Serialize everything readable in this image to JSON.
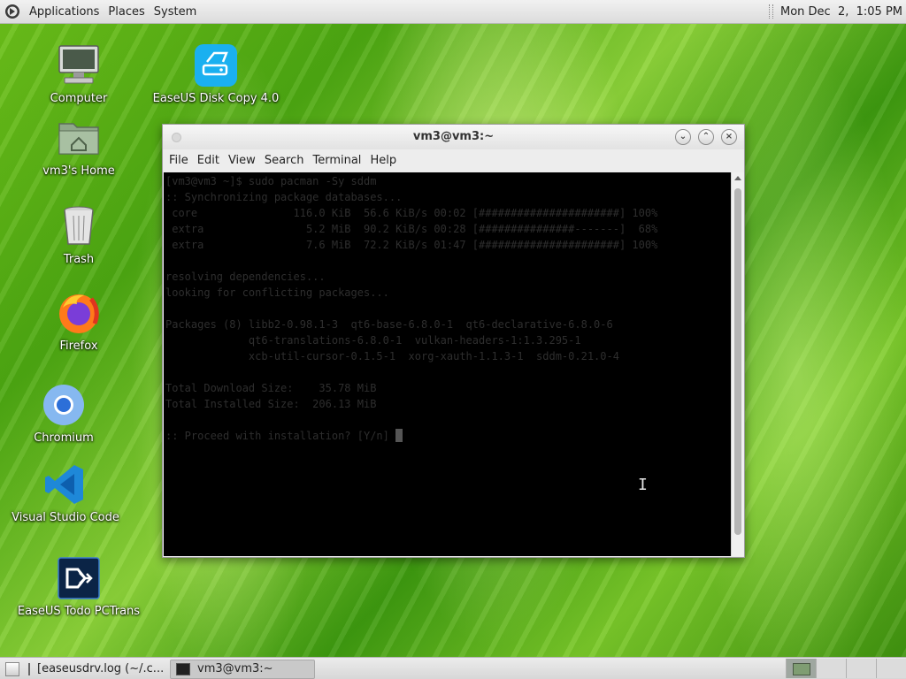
{
  "top_panel": {
    "menus": [
      "Applications",
      "Places",
      "System"
    ],
    "clock": "Mon Dec  2,  1:05 PM"
  },
  "desktop_icons": [
    {
      "label": "Computer",
      "icon": "computer-icon"
    },
    {
      "label": "EaseUS Disk Copy 4.0",
      "icon": "easeus-disk-copy-icon"
    },
    {
      "label": "vm3's Home",
      "icon": "home-folder-icon"
    },
    {
      "label": "Trash",
      "icon": "trash-icon"
    },
    {
      "label": "Firefox",
      "icon": "firefox-icon"
    },
    {
      "label": "Chromium",
      "icon": "chromium-icon"
    },
    {
      "label": "Visual Studio Code",
      "icon": "vscode-icon"
    },
    {
      "label": "EaseUS Todo PCTrans",
      "icon": "easeus-pctrans-icon"
    }
  ],
  "terminal": {
    "title": "vm3@vm3:~",
    "menu": [
      "File",
      "Edit",
      "View",
      "Search",
      "Terminal",
      "Help"
    ],
    "lines": [
      "[vm3@vm3 ~]$ sudo pacman -Sy sddm",
      ":: Synchronizing package databases...",
      " core               116.0 KiB  56.6 KiB/s 00:02 [######################] 100%",
      " extra                5.2 MiB  90.2 KiB/s 00:28 [###############-------]  68%",
      " extra                7.6 MiB  72.2 KiB/s 01:47 [######################] 100%",
      "",
      "resolving dependencies...",
      "looking for conflicting packages...",
      "",
      "Packages (8) libb2-0.98.1-3  qt6-base-6.8.0-1  qt6-declarative-6.8.0-6",
      "             qt6-translations-6.8.0-1  vulkan-headers-1:1.3.295-1",
      "             xcb-util-cursor-0.1.5-1  xorg-xauth-1.1.3-1  sddm-0.21.0-4",
      "",
      "Total Download Size:    35.78 MiB",
      "Total Installed Size:  206.13 MiB",
      "",
      ":: Proceed with installation? [Y/n] "
    ]
  },
  "taskbar": {
    "tasks": [
      {
        "label": "[easeusdrv.log (~/.c...",
        "active": false
      },
      {
        "label": "vm3@vm3:~",
        "active": true
      }
    ]
  },
  "colors": {
    "terminal_bg": "#000000",
    "terminal_fg": "#2e2e2e",
    "panel": "#e4e4e4",
    "wallpaper": "#5cb517"
  }
}
